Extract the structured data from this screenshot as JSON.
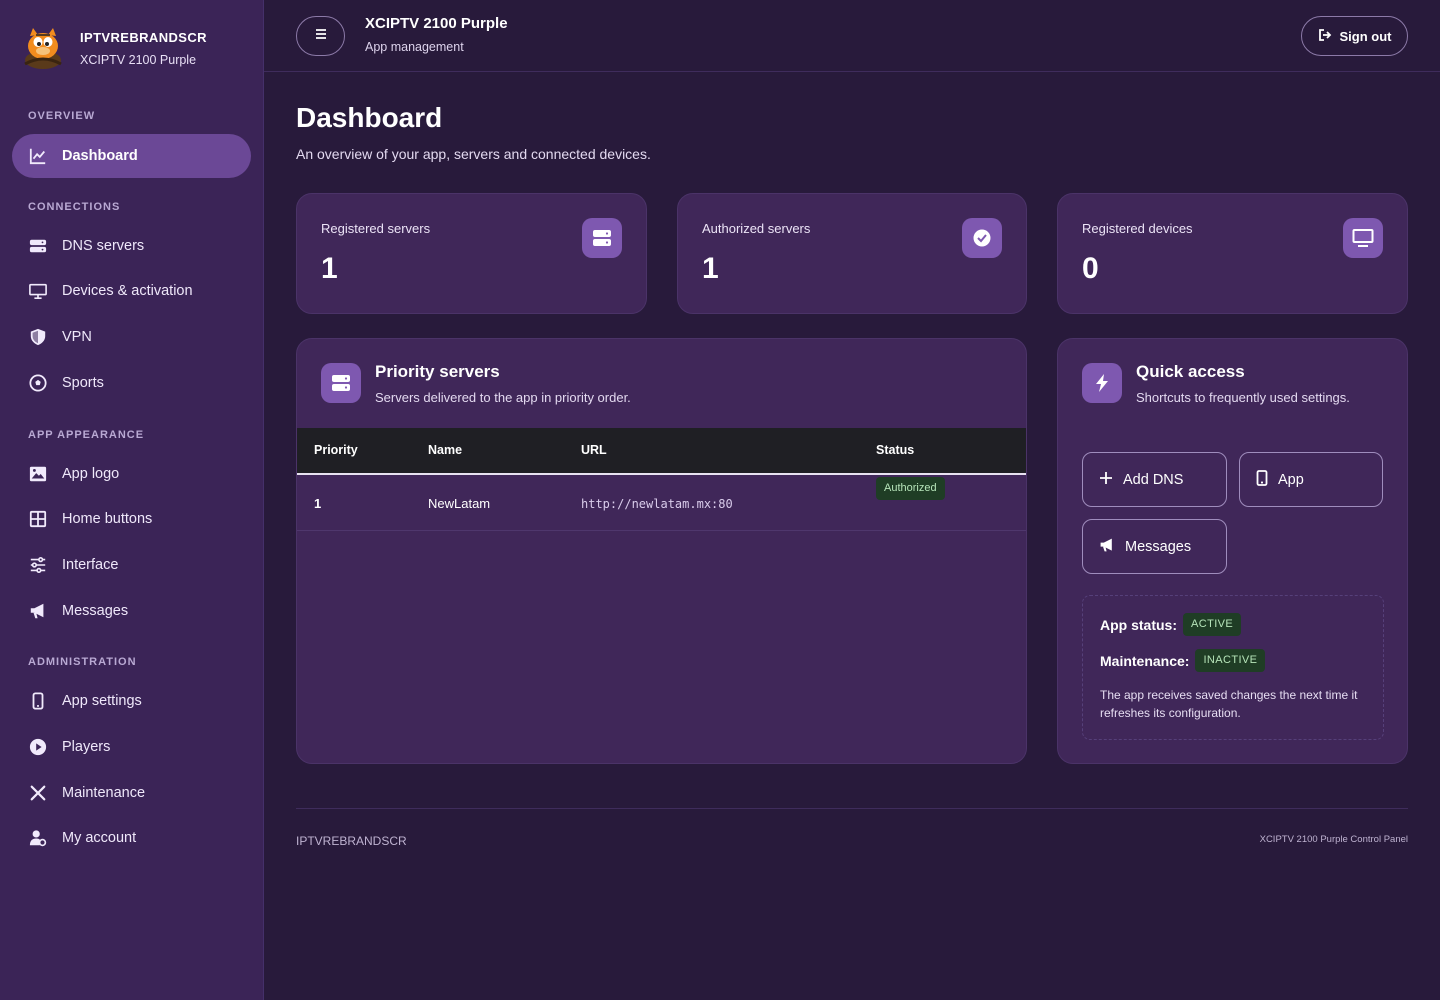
{
  "brand": {
    "name": "IPTVREBRANDSCR",
    "sub": "XCIPTV 2100 Purple"
  },
  "sidebar": {
    "sections": [
      {
        "label": "OVERVIEW"
      },
      {
        "label": "CONNECTIONS"
      },
      {
        "label": "APP APPEARANCE"
      },
      {
        "label": "ADMINISTRATION"
      }
    ],
    "items": [
      {
        "label": "Dashboard",
        "icon": "chart-line-icon",
        "active": true
      },
      {
        "label": "DNS servers",
        "icon": "server-icon"
      },
      {
        "label": "Devices & activation",
        "icon": "monitor-icon"
      },
      {
        "label": "VPN",
        "icon": "shield-icon"
      },
      {
        "label": "Sports",
        "icon": "soccer-ball-icon"
      },
      {
        "label": "App logo",
        "icon": "image-icon"
      },
      {
        "label": "Home buttons",
        "icon": "grid-icon"
      },
      {
        "label": "Interface",
        "icon": "sliders-icon"
      },
      {
        "label": "Messages",
        "icon": "megaphone-icon"
      },
      {
        "label": "App settings",
        "icon": "mobile-icon"
      },
      {
        "label": "Players",
        "icon": "play-circle-icon"
      },
      {
        "label": "Maintenance",
        "icon": "tools-icon"
      },
      {
        "label": "My account",
        "icon": "user-gear-icon"
      }
    ]
  },
  "topbar": {
    "title": "XCIPTV 2100 Purple",
    "subtitle": "App management",
    "signout_label": "Sign out"
  },
  "page": {
    "title": "Dashboard",
    "subtitle": "An overview of your app, servers and connected devices."
  },
  "stats": [
    {
      "label": "Registered servers",
      "value": "1",
      "icon": "server-icon"
    },
    {
      "label": "Authorized servers",
      "value": "1",
      "icon": "check-circle-icon"
    },
    {
      "label": "Registered devices",
      "value": "0",
      "icon": "monitor-icon"
    }
  ],
  "priority": {
    "title": "Priority servers",
    "subtitle": "Servers delivered to the app in priority order.",
    "columns": [
      "Priority",
      "Name",
      "URL",
      "Status"
    ],
    "rows": [
      {
        "priority": "1",
        "name": "NewLatam",
        "url": "http://newlatam.mx:80",
        "status": "Authorized"
      }
    ]
  },
  "quick": {
    "title": "Quick access",
    "subtitle": "Shortcuts to frequently used settings.",
    "buttons": [
      {
        "label": "Add DNS",
        "icon": "plus-icon"
      },
      {
        "label": "App",
        "icon": "mobile-icon"
      },
      {
        "label": "Messages",
        "icon": "megaphone-icon"
      }
    ],
    "app_status_label": "App status:",
    "app_status_value": "ACTIVE",
    "maintenance_label": "Maintenance:",
    "maintenance_value": "INACTIVE",
    "note": "The app receives saved changes the next time it refreshes its configuration."
  },
  "footer": {
    "left": "IPTVREBRANDSCR",
    "right": "XCIPTV 2100 Purple Control Panel"
  },
  "colors": {
    "background": "#281a3b",
    "sidebar": "#3b2457",
    "card": "#402759",
    "accent": "#7e58b0",
    "active_nav": "#6b4896",
    "status_green_bg": "#1f3d25",
    "status_green_text": "#b6e4b9"
  }
}
